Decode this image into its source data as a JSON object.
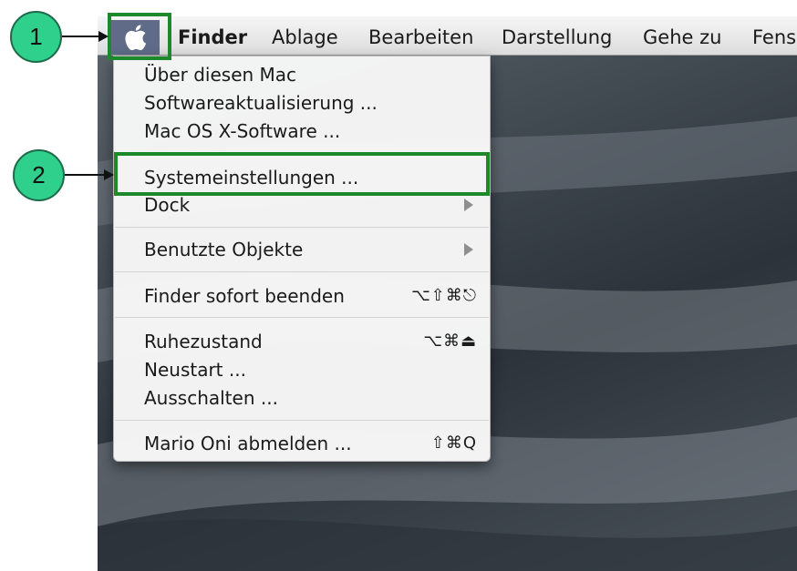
{
  "menubar": {
    "apple_icon": "apple-logo-icon",
    "app_name": "Finder",
    "menus": [
      "Ablage",
      "Bearbeiten",
      "Darstellung",
      "Gehe zu",
      "Fens"
    ]
  },
  "apple_menu": {
    "items": [
      {
        "label": "Über diesen Mac"
      },
      {
        "label": "Softwareaktualisierung ..."
      },
      {
        "label": "Mac OS X-Software ..."
      },
      {
        "label": "Systemeinstellungen ..."
      },
      {
        "label": "Dock",
        "submenu": true
      },
      {
        "label": "Benutzte Objekte",
        "submenu": true
      },
      {
        "label": "Finder sofort beenden",
        "shortcut": "⌥⇧⌘⎋"
      },
      {
        "label": "Ruhezustand",
        "shortcut": "⌥⌘⏏"
      },
      {
        "label": "Neustart ..."
      },
      {
        "label": "Ausschalten ..."
      },
      {
        "label": "Mario Oni abmelden ...",
        "shortcut": "⇧⌘Q"
      }
    ]
  },
  "annotations": {
    "step1": "1",
    "step2": "2",
    "highlight_color": "#1c8a2a",
    "badge_color": "#2fcf8c"
  }
}
